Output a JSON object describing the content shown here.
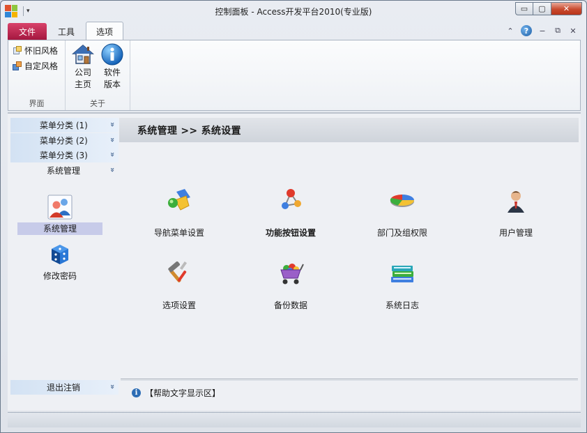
{
  "window": {
    "title": "控制面板 - Access开发平台2010(专业版)",
    "qat_dropdown": "▾",
    "minimize": "▭",
    "maximize": "▢",
    "close": "✕"
  },
  "ribbon_tabs": {
    "file": "文件",
    "tools": "工具",
    "options": "选项"
  },
  "ribbon_right": {
    "collapse": "⌃",
    "help": "?",
    "minimize": "−",
    "restore": "⧉",
    "close": "✕"
  },
  "ribbon": {
    "interface_group": {
      "label": "界面",
      "classic_style": "怀旧风格",
      "custom_style": "自定风格"
    },
    "about_group": {
      "label": "关于",
      "company_home": [
        "公司",
        "主页"
      ],
      "software_version": [
        "软件",
        "版本"
      ]
    }
  },
  "sidebar": {
    "categories": [
      {
        "label": "菜单分类 (1)",
        "chevron": "»"
      },
      {
        "label": "菜单分类 (2)",
        "chevron": "»"
      },
      {
        "label": "菜单分类 (3)",
        "chevron": "»"
      },
      {
        "label": "系统管理",
        "chevron": "»"
      }
    ],
    "items": [
      {
        "label": "系统管理",
        "icon": "users-icon"
      },
      {
        "label": "修改密码",
        "icon": "dice-icon"
      }
    ],
    "exit": {
      "label": "退出注销",
      "chevron": "»"
    }
  },
  "main": {
    "breadcrumb": "系统管理  >>  系统设置",
    "functions": [
      {
        "label": "导航菜单设置",
        "icon": "shapes-icon"
      },
      {
        "label": "功能按钮设置",
        "icon": "molecule-icon"
      },
      {
        "label": "部门及组权限",
        "icon": "pie-chart-icon"
      },
      {
        "label": "用户管理",
        "icon": "user-icon"
      },
      {
        "label": "选项设置",
        "icon": "tools-icon"
      },
      {
        "label": "备份数据",
        "icon": "cart-icon"
      },
      {
        "label": "系统日志",
        "icon": "books-icon"
      }
    ],
    "help_text": "【帮助文字显示区】",
    "help_icon": "i"
  }
}
